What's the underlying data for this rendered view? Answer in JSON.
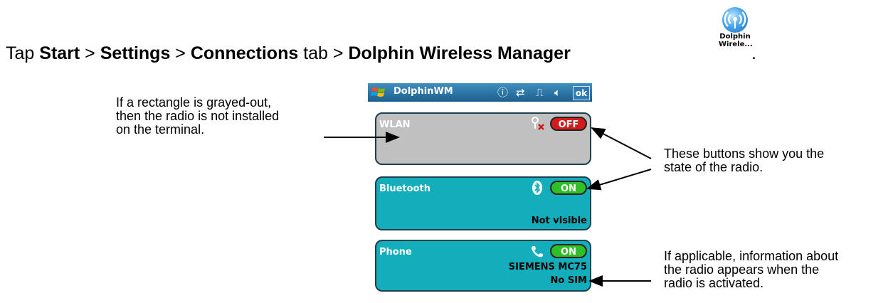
{
  "instruction": {
    "prefix": "Tap ",
    "start": "Start",
    "sep1": " > ",
    "settings": "Settings",
    "sep2": " > ",
    "connections": "Connections",
    "tab_word": " tab > ",
    "manager": "Dolphin Wireless Manager",
    "period": "."
  },
  "app_icon": {
    "icon": "wireless-signal-icon",
    "label_line1": "Dolphin",
    "label_line2": "Wirele..."
  },
  "screen": {
    "title": "DolphinWM",
    "ok_label": "ok",
    "status_icons": [
      "info-icon",
      "sync-arrows-icon",
      "connectivity-icon",
      "speaker-icon"
    ],
    "panels": [
      {
        "name": "WLAN",
        "toggle": "OFF",
        "state": "disabled",
        "icon": "wlan-disabled-icon",
        "lines": []
      },
      {
        "name": "Bluetooth",
        "toggle": "ON",
        "state": "on",
        "icon": "bluetooth-icon",
        "lines": [
          "Not visible"
        ]
      },
      {
        "name": "Phone",
        "toggle": "ON",
        "state": "on",
        "icon": "phone-icon",
        "lines": [
          "SIEMENS MC75",
          "No SIM"
        ]
      }
    ]
  },
  "annotations": {
    "grayed": [
      "If a rectangle is grayed-out,",
      "then the radio is not installed",
      "on the terminal."
    ],
    "buttons": [
      "These buttons show you the",
      "state of the radio."
    ],
    "info": [
      "If applicable, information about",
      "the radio appears when the",
      "radio is activated."
    ]
  },
  "colors": {
    "panel_active": "#14adbb",
    "panel_disabled": "#c0c0c0",
    "toggle_on": "#2fbf29",
    "toggle_off": "#d01c1c",
    "titlebar": "#1d5f8e"
  }
}
